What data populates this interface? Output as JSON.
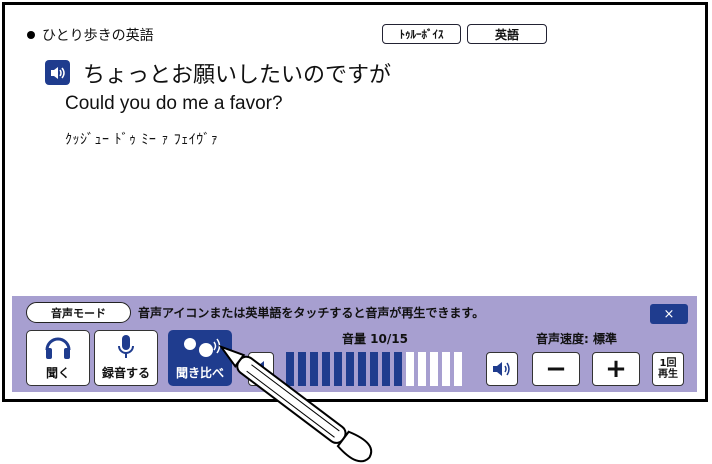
{
  "breadcrumb": {
    "title": "ひとり歩きの英語"
  },
  "toggles": {
    "true_voice": "ﾄｩﾙｰﾎﾞｲｽ",
    "language": "英語"
  },
  "phrase": {
    "japanese": "ちょっとお願いしたいのですが",
    "english": "Could you do me a favor?",
    "pronunciation": "ｸｯｼﾞｭｰ ﾄﾞｩ ﾐｰ ｧ ﾌｪｲｳﾞｧ"
  },
  "voice_panel": {
    "mode_label": "音声モード",
    "message": "音声アイコンまたは英単語をタッチすると音声が再生できます。",
    "close_label": "×",
    "buttons": {
      "listen": "聞く",
      "record": "録音する",
      "compare": "聞き比べ"
    },
    "volume": {
      "label": "音量 10/15",
      "level": 10,
      "max": 15
    },
    "speed": {
      "label": "音声速度: 標準",
      "slower": "−",
      "faster": "+"
    },
    "play_once": {
      "line1": "1回",
      "line2": "再生"
    }
  },
  "colors": {
    "accent": "#1f3c8e",
    "panel": "#a79fd0"
  }
}
